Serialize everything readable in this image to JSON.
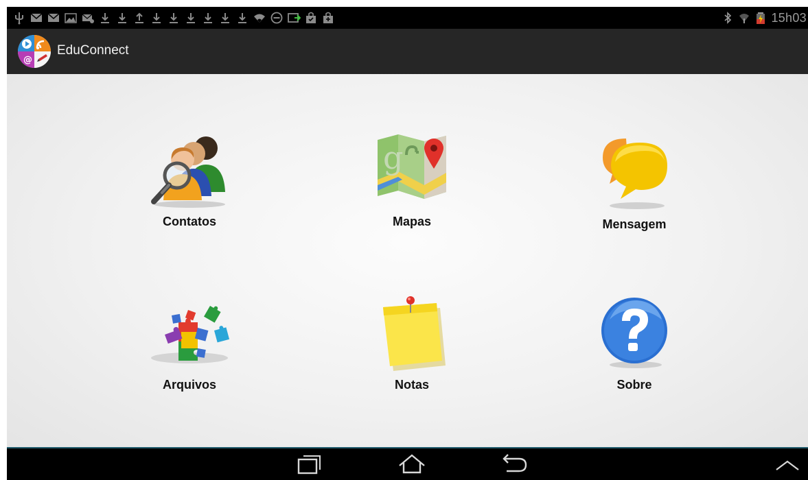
{
  "status_bar": {
    "notification_icons": [
      "usb-icon",
      "gmail-icon",
      "gmail-icon",
      "gallery-icon",
      "email-icon",
      "download-icon",
      "download-icon",
      "upload-icon",
      "download-icon",
      "download-icon",
      "download-icon",
      "download-icon",
      "download-icon",
      "download-icon",
      "wifi-icon",
      "minus-circle-icon",
      "screen-share-icon",
      "shopping-bag-icon",
      "shopping-bag-icon"
    ],
    "system_icons": [
      "bluetooth-icon",
      "signal-icon",
      "battery-icon"
    ],
    "clock": "15h03"
  },
  "action_bar": {
    "app_title": "EduConnect",
    "app_icon": "educonnect-logo-icon"
  },
  "menu": {
    "items": [
      {
        "label": "Contatos",
        "icon": "contacts-magnifier-icon"
      },
      {
        "label": "Mapas",
        "icon": "google-maps-icon"
      },
      {
        "label": "Mensagem",
        "icon": "chat-bubbles-icon"
      },
      {
        "label": "Arquivos",
        "icon": "puzzle-pieces-icon"
      },
      {
        "label": "Notas",
        "icon": "sticky-note-icon"
      },
      {
        "label": "Sobre",
        "icon": "help-question-icon"
      }
    ]
  },
  "nav_bar": {
    "buttons": [
      "recent-apps-icon",
      "home-icon",
      "back-icon",
      "chevron-up-icon"
    ]
  },
  "colors": {
    "status_bar_bg": "#000000",
    "action_bar_bg": "#262626",
    "content_bg": "#f1f1f1",
    "divider": "#1f5a6b",
    "nav_bar_bg": "#000000"
  }
}
